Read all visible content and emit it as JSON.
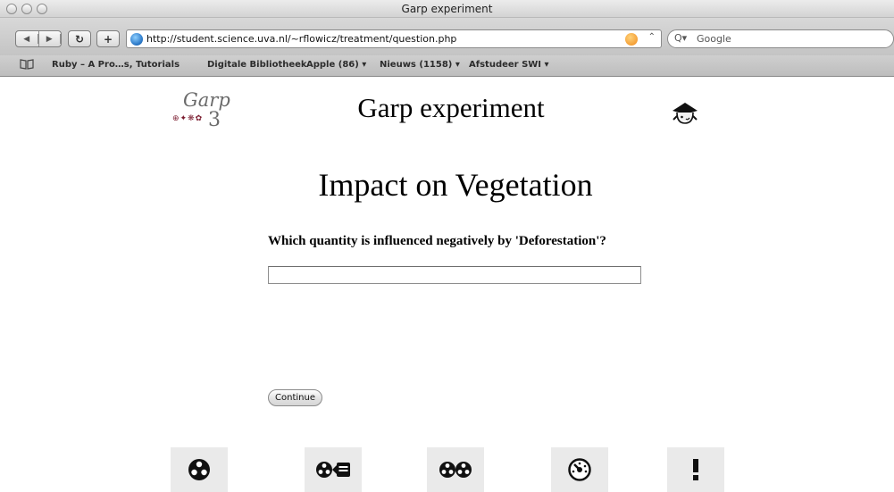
{
  "window": {
    "title": "Garp experiment"
  },
  "toolbar": {
    "url": "http://student.science.uva.nl/~rflowicz/treatment/question.php",
    "search_placeholder": "Google"
  },
  "bookmarks": [
    "Ruby – A Pro…s, Tutorials",
    "Digitale Bibliotheek",
    "Apple (86) ▾",
    "Nieuws (1158) ▾",
    "Afstudeer SWI ▾"
  ],
  "page": {
    "logo": {
      "word": "Garp",
      "number": "3"
    },
    "app_title": "Garp experiment",
    "heading": "Impact on Vegetation",
    "question": "Which quantity is influenced negatively by 'Deforestation'?",
    "answer_value": "",
    "continue_label": "Continue"
  },
  "bottom_nav": [
    {
      "icon": "model-icon"
    },
    {
      "icon": "model-to-list-icon"
    },
    {
      "icon": "model-compare-icon"
    },
    {
      "icon": "dashboard-icon"
    },
    {
      "icon": "info-icon"
    }
  ],
  "colors": {
    "logo_accent": "#7a1b2e",
    "logo_gray": "#6b6b6b",
    "tile_bg": "#eaeaea"
  }
}
